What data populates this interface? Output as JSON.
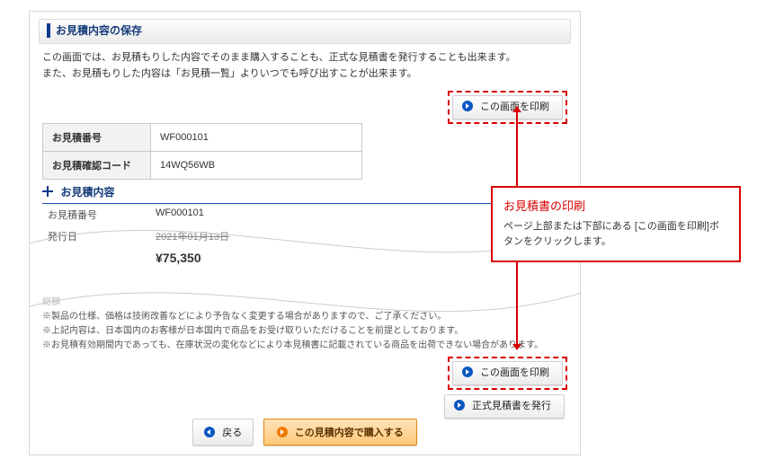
{
  "header": {
    "title": "お見積内容の保存"
  },
  "lead": {
    "line1": "この画面では、お見積もりした内容でそのまま購入することも、正式な見積書を発行することも出来ます。",
    "line2": "また、お見積もりした内容は「お見積一覧」よりいつでも呼び出すことが出来ます。"
  },
  "buttons": {
    "print": "この画面を印刷",
    "issue": "正式見積書を発行",
    "back": "戻る",
    "buy": "この見積内容で購入する"
  },
  "info_table": {
    "rows": [
      {
        "label": "お見積番号",
        "value": "WF000101"
      },
      {
        "label": "お見積確認コード",
        "value": "14WQ56WB"
      }
    ]
  },
  "sub_header": {
    "title": "お見積内容"
  },
  "details": {
    "rows": [
      {
        "label": "お見積番号",
        "value": "WF000101",
        "struck": false
      },
      {
        "label": "発行日",
        "value": "2021年01月13日",
        "struck": true
      }
    ],
    "price": "¥75,350"
  },
  "notes": {
    "grey_label": "総額",
    "lines": [
      "※製品の仕様、価格は技術改善などにより予告なく変更する場合がありますので、ご了承ください。",
      "※上記内容は、日本国内のお客様が日本国内で商品をお受け取りいただけることを前提としております。",
      "※お見積有効期間内であっても、在庫状況の変化などにより本見積書に記載されている商品を出荷できない場合があります。"
    ]
  },
  "callout": {
    "title": "お見積書の印刷",
    "body": "ページ上部または下部にある\n[この画面を印刷]ボタンをクリックします。"
  }
}
